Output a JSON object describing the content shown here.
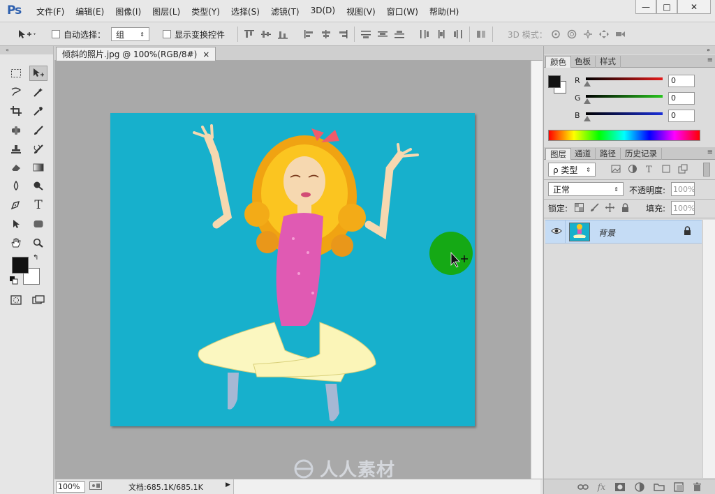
{
  "app": {
    "logo": "Ps"
  },
  "menu": [
    "文件(F)",
    "编辑(E)",
    "图像(I)",
    "图层(L)",
    "类型(Y)",
    "选择(S)",
    "滤镜(T)",
    "3D(D)",
    "视图(V)",
    "窗口(W)",
    "帮助(H)"
  ],
  "window_controls": {
    "minimize": "—",
    "maximize": "□",
    "close": "✕"
  },
  "options": {
    "auto_select_label": "自动选择：",
    "auto_select_value": "组",
    "show_transform_label": "显示变换控件",
    "mode_3d_label": "3D 模式："
  },
  "document": {
    "tab_title": "倾斜的照片.jpg @ 100%(RGB/8#)",
    "tab_close": "×",
    "zoom": "100%",
    "doc_size": "文档:685.1K/685.1K",
    "status_arrow": "▶"
  },
  "panels": {
    "color_tabs": [
      "颜色",
      "色板",
      "样式"
    ],
    "rgb": [
      {
        "label": "R",
        "value": "0",
        "color": "#e41b1b"
      },
      {
        "label": "G",
        "value": "0",
        "color": "#29c41e"
      },
      {
        "label": "B",
        "value": "0",
        "color": "#1a2fd9"
      }
    ],
    "layers_tabs": [
      "图层",
      "通道",
      "路径",
      "历史记录"
    ],
    "filter_label": "ρ 类型",
    "blend_mode": "正常",
    "opacity_label": "不透明度:",
    "opacity_value": "100%",
    "lock_label": "锁定:",
    "fill_label": "填充:",
    "fill_value": "100%",
    "layer_name": "背景",
    "panel_menu": "≡"
  },
  "colors": {
    "canvas": "#17b0cc",
    "cursor_highlight": "#15a915",
    "foreground": "#111111",
    "background": "#ffffff",
    "selected_layer": "#c5dcf5"
  },
  "watermark": "人人素材"
}
